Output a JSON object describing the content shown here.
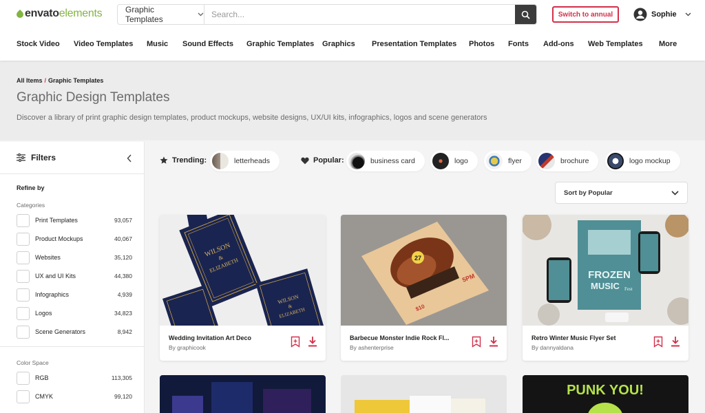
{
  "header": {
    "logo_bold": "envato",
    "logo_light": "elements",
    "search_category": "Graphic Templates",
    "search_placeholder": "Search...",
    "switch_label": "Switch to annual",
    "user_name": "Sophie"
  },
  "nav": [
    "Stock Video",
    "Video Templates",
    "Music",
    "Sound Effects",
    "Graphic Templates",
    "Graphics",
    "Presentation Templates",
    "Photos",
    "Fonts",
    "Add-ons",
    "Web Templates",
    "More"
  ],
  "breadcrumb": {
    "root": "All Items",
    "sep": "/",
    "current": "Graphic Templates"
  },
  "page_title": "Graphic Design Templates",
  "page_description": "Discover a library of print graphic design templates, product mockups, website designs, UX/UI kits, infographics, logos and scene generators",
  "filters": {
    "title": "Filters",
    "refine_label": "Refine by",
    "categories_label": "Categories",
    "categories": [
      {
        "label": "Print Templates",
        "count": "93,057"
      },
      {
        "label": "Product Mockups",
        "count": "40,067"
      },
      {
        "label": "Websites",
        "count": "35,120"
      },
      {
        "label": "UX and UI Kits",
        "count": "44,380"
      },
      {
        "label": "Infographics",
        "count": "4,939"
      },
      {
        "label": "Logos",
        "count": "34,823"
      },
      {
        "label": "Scene Generators",
        "count": "8,942"
      }
    ],
    "color_space_label": "Color Space",
    "color_spaces": [
      {
        "label": "RGB",
        "count": "113,305"
      },
      {
        "label": "CMYK",
        "count": "99,120"
      }
    ]
  },
  "trending_label": "Trending:",
  "trending": [
    "letterheads"
  ],
  "popular_label": "Popular:",
  "popular": [
    "business card",
    "logo",
    "flyer",
    "brochure",
    "logo mockup"
  ],
  "sort_label": "Sort by Popular",
  "cards": [
    {
      "title": "Wedding Invitation Art Deco",
      "author": "By graphicook"
    },
    {
      "title": "Barbecue Monster Indie Rock Fl...",
      "author": "By ashenterprise"
    },
    {
      "title": "Retro Winter Music Flyer Set",
      "author": "By dannyaldana"
    }
  ],
  "artwork_text": {
    "wedding": [
      "WILSON",
      "&",
      "ELIZABETH"
    ],
    "bbq": [
      "27",
      "5PM",
      "$10"
    ],
    "frozen": [
      "FROZEN",
      "MUSIC",
      "Fest"
    ],
    "punk": "PUNK YOU!"
  },
  "colors": {
    "accent": "#d32f4a",
    "brand_green": "#82b541"
  }
}
